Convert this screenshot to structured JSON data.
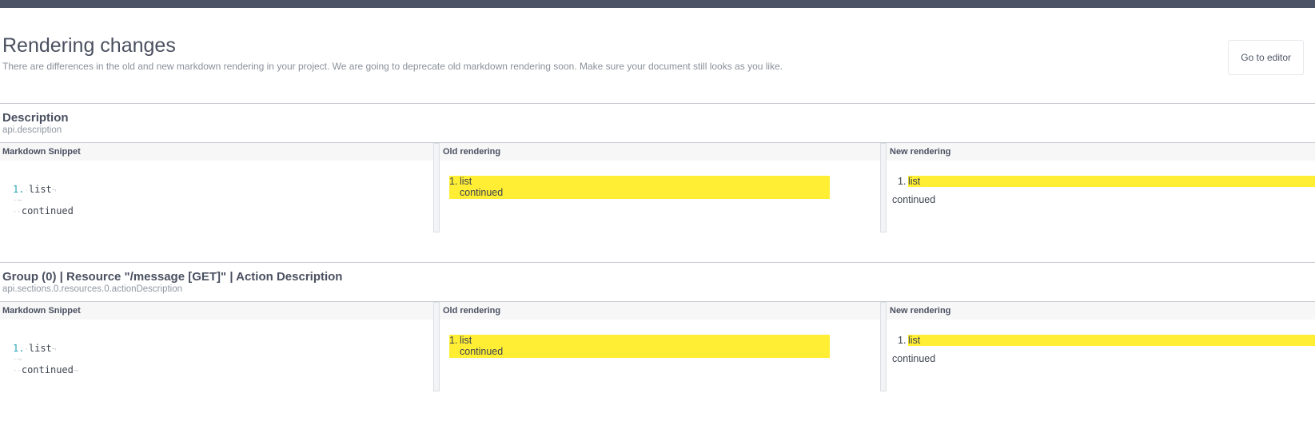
{
  "header": {
    "title": "Rendering changes",
    "subtitle": "There are differences in the old and new markdown rendering in your project. We are going to deprecate old markdown rendering soon. Make sure your document still looks as you like.",
    "editor_button": "Go to editor"
  },
  "columns": {
    "markdown": "Markdown Snippet",
    "old": "Old rendering",
    "new": "New rendering"
  },
  "sections": [
    {
      "title": "Description",
      "path": "api.description",
      "snippet": {
        "number": "1.",
        "item": "list",
        "continued": "continued"
      },
      "old": {
        "number": "1.",
        "item": "list",
        "continued": "continued"
      },
      "new": {
        "number": "1.",
        "item": "list",
        "continued": "continued"
      }
    },
    {
      "title": "Group (0) | Resource \"/message [GET]\" | Action Description",
      "path": "api.sections.0.resources.0.actionDescription",
      "snippet": {
        "number": "1.",
        "item": "list",
        "continued": "continued"
      },
      "old": {
        "number": "1.",
        "item": "list",
        "continued": "continued"
      },
      "new": {
        "number": "1.",
        "item": "list",
        "continued": "continued"
      }
    }
  ],
  "whitespace_glyphs": {
    "space": "·",
    "newline": "¬"
  },
  "colors": {
    "topbar": "#4c5366",
    "highlight": "#ffee33",
    "list_number": "#2aa4b8"
  }
}
